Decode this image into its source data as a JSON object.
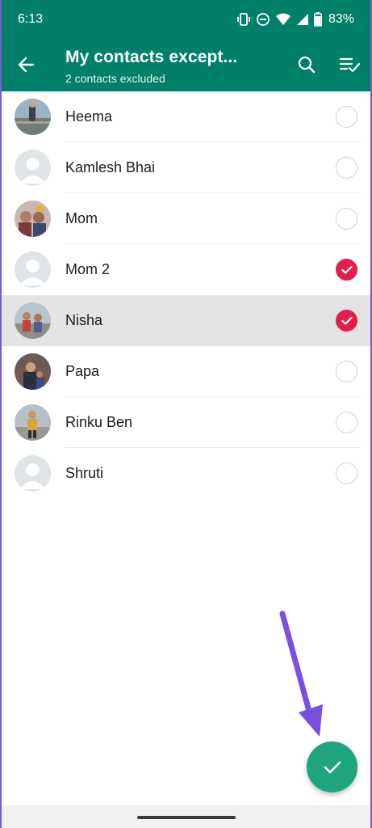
{
  "status": {
    "time": "6:13",
    "battery": "83%",
    "icons": [
      "vibrate-icon",
      "dnd-icon",
      "wifi-icon",
      "signal-icon",
      "battery-icon"
    ]
  },
  "header": {
    "title": "My contacts except...",
    "subtitle": "2 contacts excluded",
    "back_icon": "back-arrow-icon",
    "search_icon": "search-icon",
    "select_all_icon": "select-all-icon"
  },
  "contacts": [
    {
      "name": "Heema",
      "avatar": "photo",
      "checked": false
    },
    {
      "name": "Kamlesh Bhai",
      "avatar": "default",
      "checked": false
    },
    {
      "name": "Mom",
      "avatar": "photo",
      "checked": false
    },
    {
      "name": "Mom 2",
      "avatar": "default",
      "checked": true
    },
    {
      "name": "Nisha",
      "avatar": "photo",
      "checked": true
    },
    {
      "name": "Papa",
      "avatar": "photo",
      "checked": false
    },
    {
      "name": "Rinku Ben",
      "avatar": "photo",
      "checked": false
    },
    {
      "name": "Shruti",
      "avatar": "default",
      "checked": false
    }
  ],
  "fab": {
    "icon": "check-icon"
  },
  "colors": {
    "appbar": "#008069",
    "checked": "#e31e4c",
    "fab": "#1fa57e",
    "annotation_arrow": "#7b4fe0"
  }
}
